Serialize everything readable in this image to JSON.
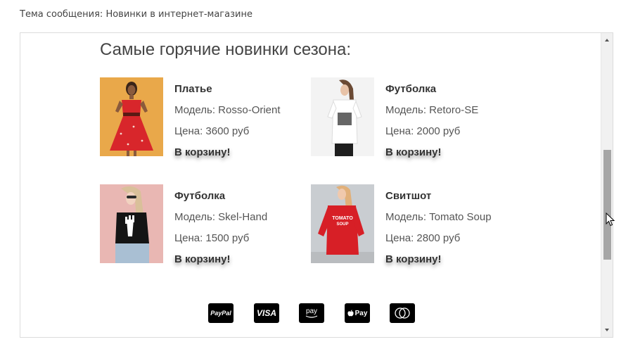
{
  "subject": "Тема сообщения: Новинки в интернет-магазине",
  "headline": "Самые горячие новинки сезона:",
  "cart_label": "В корзину!",
  "products": [
    {
      "name": "Платье",
      "model": "Модель: Rosso-Orient",
      "price": "Цена: 3600 руб"
    },
    {
      "name": "Футболка",
      "model": "Модель: Retoro-SE",
      "price": "Цена: 2000 руб"
    },
    {
      "name": "Футболка",
      "model": "Модель: Skel-Hand",
      "price": "Цена: 1500 руб"
    },
    {
      "name": "Свитшот",
      "model": "Модель: Tomato Soup",
      "price": "Цена: 2800 руб"
    }
  ],
  "payments": {
    "paypal": "PayPal",
    "visa": "VISA",
    "amazon": "pay",
    "apple": "Pay"
  },
  "sweatshirt_print": {
    "line1": "TOMATO",
    "line2": "SOUP"
  },
  "colors": {
    "dress_bg": "#e9a84a",
    "dress": "#d8262b",
    "sweatshirt": "#d71f26"
  }
}
